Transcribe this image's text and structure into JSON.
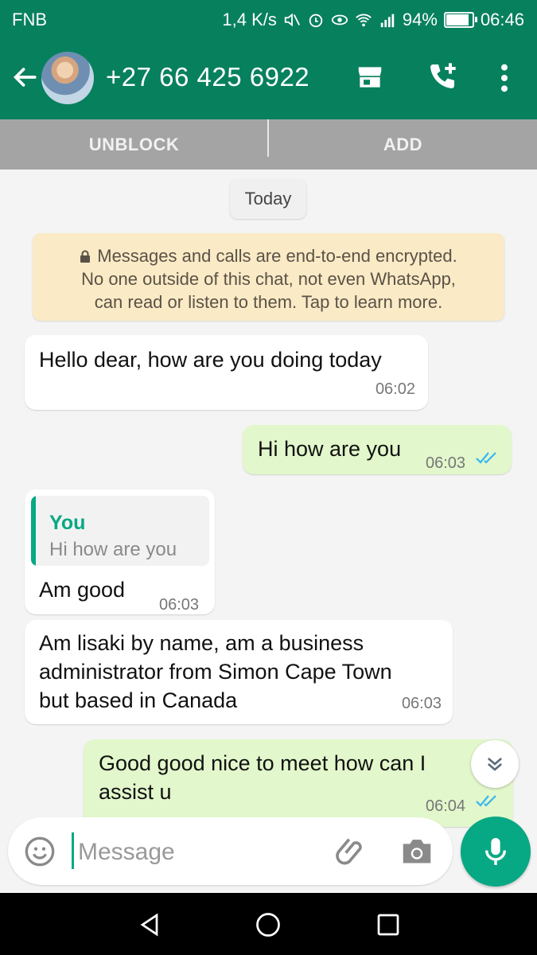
{
  "status_bar": {
    "carrier": "FNB",
    "speed": "1,4 K/s",
    "battery": "94%",
    "battery_level": 0.94,
    "time": "06:46",
    "icons": [
      "mute-icon",
      "alarm-icon",
      "eye-icon",
      "wifi-icon",
      "signal-icon",
      "battery-icon"
    ]
  },
  "header": {
    "contact_name": "+27 66 425 6922",
    "icons": [
      "back-arrow-icon",
      "avatar",
      "store-icon",
      "add-call-icon",
      "more-vert-icon"
    ]
  },
  "action_bar": {
    "unblock_label": "UNBLOCK",
    "add_label": "ADD"
  },
  "chat": {
    "date_chip": "Today",
    "encryption_notice": {
      "line1": "Messages and calls are end-to-end encrypted.",
      "line2": "No one outside of this chat, not even WhatsApp,",
      "line3": "can read or listen to them. Tap to learn more."
    },
    "messages": [
      {
        "direction": "in",
        "text": "Hello dear, how are you doing today",
        "time": "06:02"
      },
      {
        "direction": "out",
        "text": "Hi how are you",
        "time": "06:03",
        "ticks": "read"
      },
      {
        "direction": "in",
        "quote_author": "You",
        "quote_text": "Hi how are you",
        "text": "Am good",
        "time": "06:03"
      },
      {
        "direction": "in",
        "line1": "Am lisaki by name, am a business",
        "line2": "administrator from Simon Cape Town",
        "line3": "but based in Canada",
        "time": "06:03"
      },
      {
        "direction": "out",
        "line1": "Good good nice to meet how can I",
        "line2": "assist u",
        "time": "06:04",
        "ticks": "read"
      }
    ]
  },
  "composer": {
    "placeholder": "Message",
    "icons": [
      "emoji-icon",
      "attach-icon",
      "camera-icon",
      "mic-icon"
    ]
  },
  "nav_bar": {
    "icons": [
      "back-triangle-icon",
      "home-circle-icon",
      "recents-square-icon"
    ]
  },
  "colors": {
    "header": "#07805e",
    "accent": "#07a884",
    "outgoing_bubble": "#e2f7cb",
    "incoming_bubble": "#ffffff",
    "encryption_bg": "#faeac6",
    "read_ticks": "#34b7f1"
  }
}
